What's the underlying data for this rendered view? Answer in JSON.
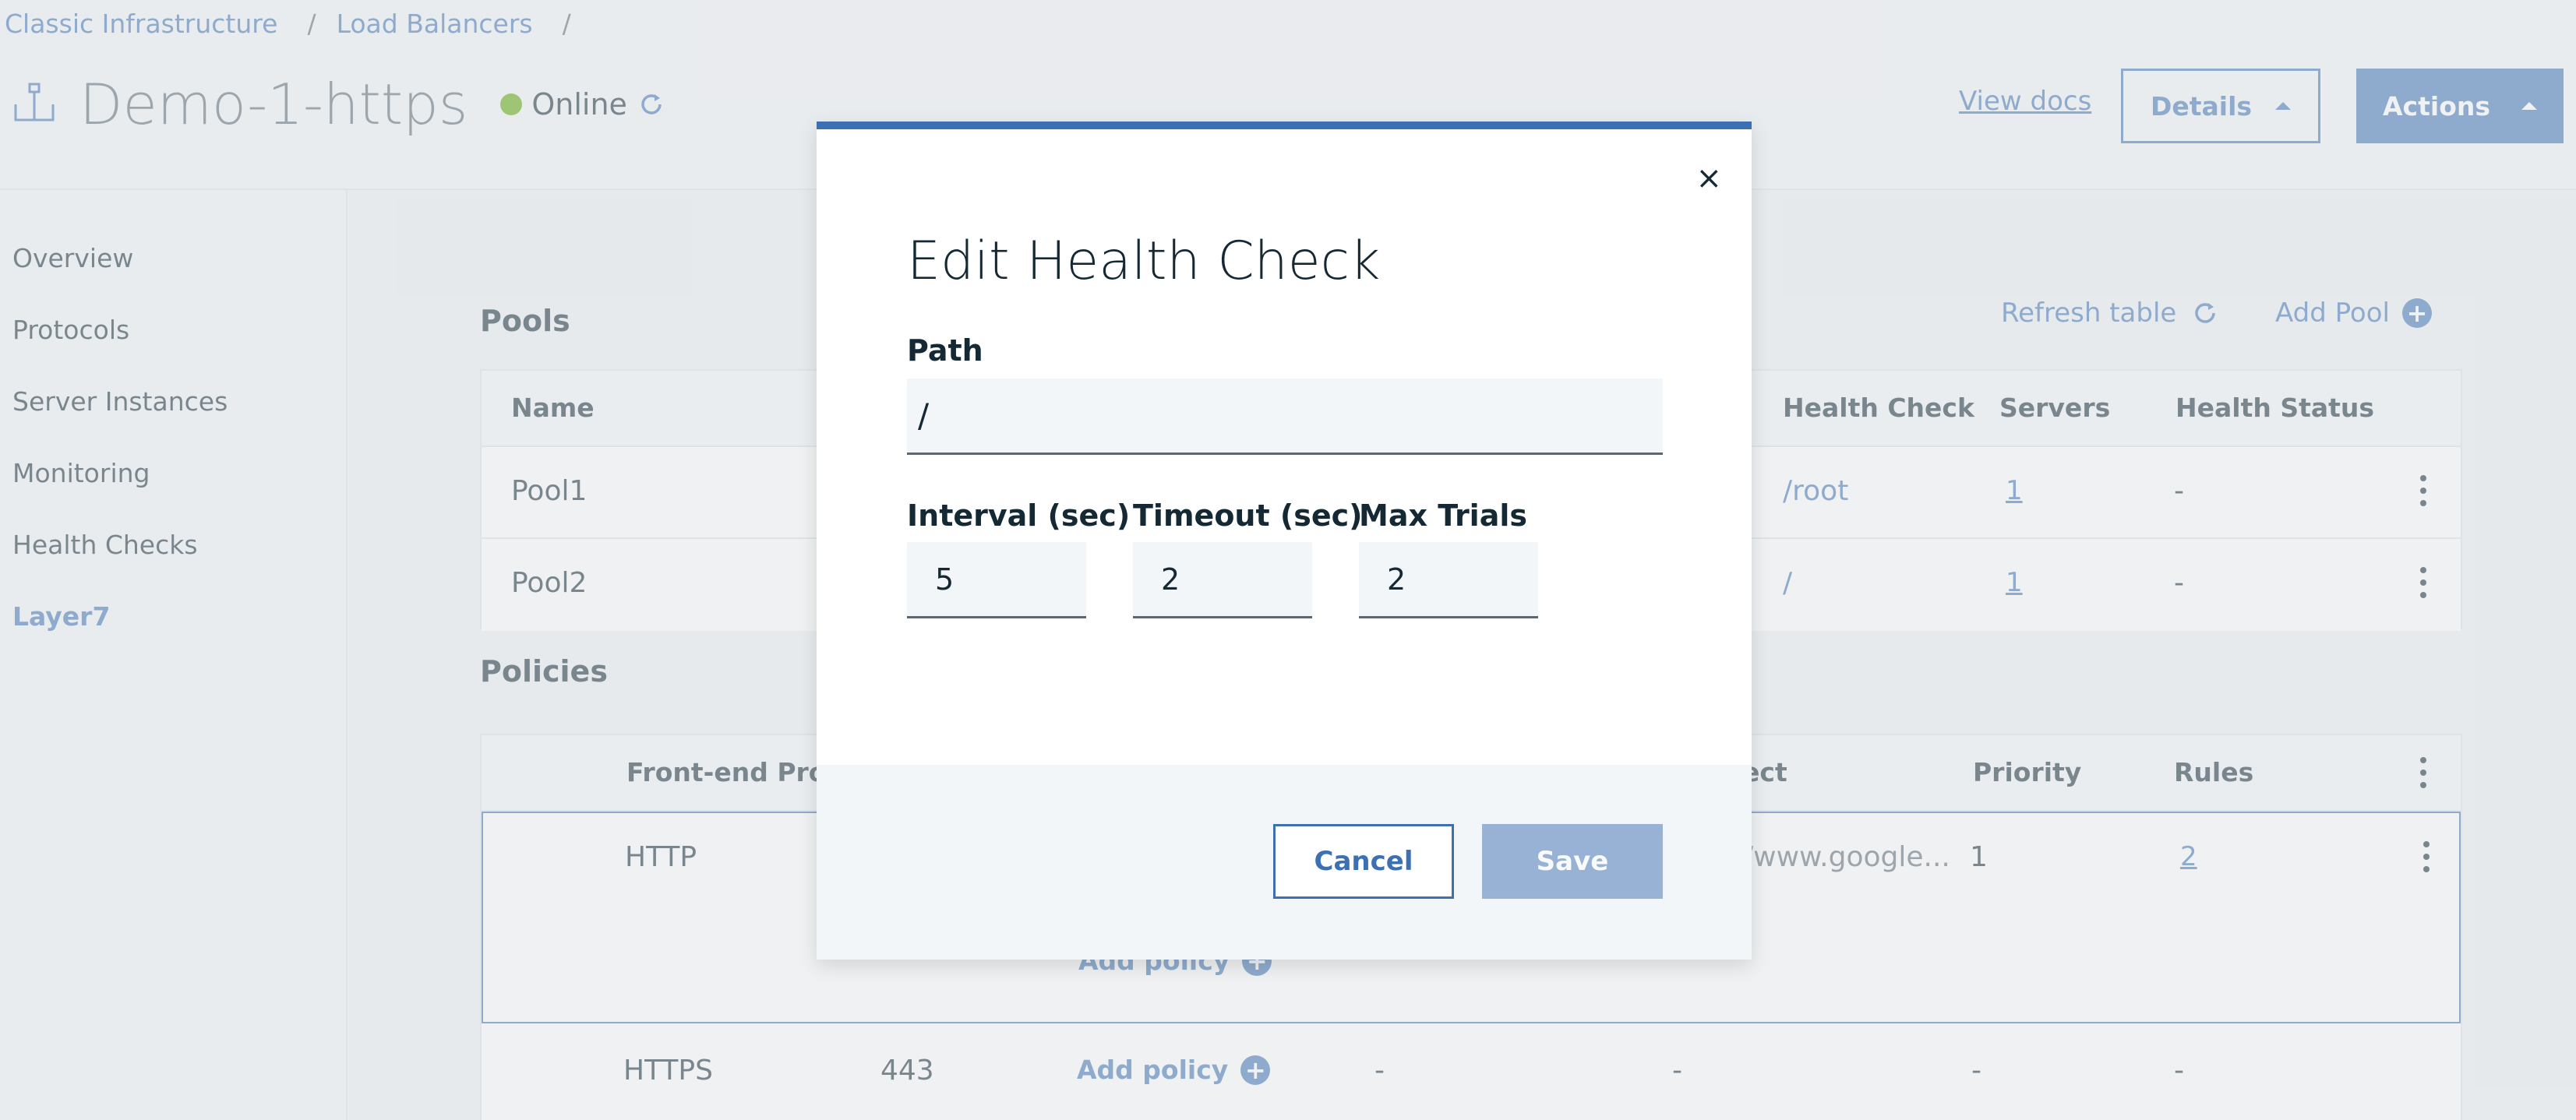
{
  "breadcrumb": {
    "items": [
      "Classic Infrastructure",
      "Load Balancers"
    ],
    "separator": "/"
  },
  "header": {
    "icon": "load-balancer-icon",
    "title": "Demo-1-https",
    "status": "Online",
    "status_color": "#5aa700",
    "view_docs": "View docs",
    "details_label": "Details",
    "actions_label": "Actions"
  },
  "sidebar": {
    "items": [
      {
        "label": "Overview",
        "active": false
      },
      {
        "label": "Protocols",
        "active": false
      },
      {
        "label": "Server Instances",
        "active": false
      },
      {
        "label": "Monitoring",
        "active": false
      },
      {
        "label": "Health Checks",
        "active": false
      },
      {
        "label": "Layer7",
        "active": true
      }
    ]
  },
  "pools": {
    "title": "Pools",
    "refresh_label": "Refresh table",
    "add_label": "Add Pool",
    "columns": [
      "Name",
      "Health Check",
      "Servers",
      "Health Status"
    ],
    "rows": [
      {
        "name": "Pool1",
        "health_check": "/root",
        "servers": "1",
        "health_status": "-"
      },
      {
        "name": "Pool2",
        "health_check": "/",
        "servers": "1",
        "health_status": "-"
      }
    ]
  },
  "policies": {
    "title": "Policies",
    "columns": [
      "Front-end Proto",
      "ect",
      "Priority",
      "Rules"
    ],
    "rows": [
      {
        "protocol": "HTTP",
        "redirect": "/www.google...",
        "priority": "1",
        "rules": "2",
        "add_policy": "Add policy"
      },
      {
        "protocol": "HTTPS",
        "port": "443",
        "add_policy": "Add policy",
        "c1": "-",
        "c2": "-",
        "c3": "-",
        "c4": "-"
      }
    ]
  },
  "modal": {
    "title": "Edit Health Check",
    "path_label": "Path",
    "path_value": "/",
    "interval_label": "Interval (sec)",
    "interval_value": "5",
    "timeout_label": "Timeout (sec)",
    "timeout_value": "2",
    "max_trials_label": "Max Trials",
    "max_trials_value": "2",
    "cancel_label": "Cancel",
    "save_label": "Save",
    "close_glyph": "×"
  },
  "colors": {
    "accent": "#3d70b2",
    "text": "#152935",
    "muted": "#5a6872",
    "online": "#5aa700"
  }
}
